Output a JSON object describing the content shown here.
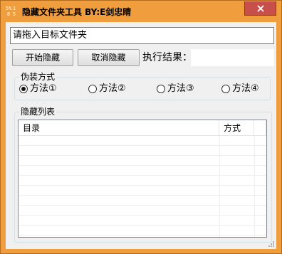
{
  "window": {
    "title": "隐藏文件夹工具 BY:E剑忠睛",
    "icon_glyphs": [
      "5%",
      "1",
      "8",
      "5"
    ],
    "close_icon": "close-icon"
  },
  "path_input": {
    "value": "请拖入目标文件夹"
  },
  "buttons": {
    "start_label": "开始隐藏",
    "cancel_label": "取消隐藏"
  },
  "result": {
    "label": "执行结果：",
    "value": ""
  },
  "mode_group": {
    "title": "伪装方式",
    "options": [
      {
        "label": "方法①",
        "selected": true
      },
      {
        "label": "方法②",
        "selected": false
      },
      {
        "label": "方法③",
        "selected": false
      },
      {
        "label": "方法④",
        "selected": false
      }
    ]
  },
  "list_group": {
    "title": "隐藏列表",
    "columns": [
      "目录",
      "方式"
    ],
    "rows": []
  },
  "colors": {
    "titlebar": "#f09d3e",
    "close": "#c7504b",
    "client": "#f0f0f0"
  }
}
